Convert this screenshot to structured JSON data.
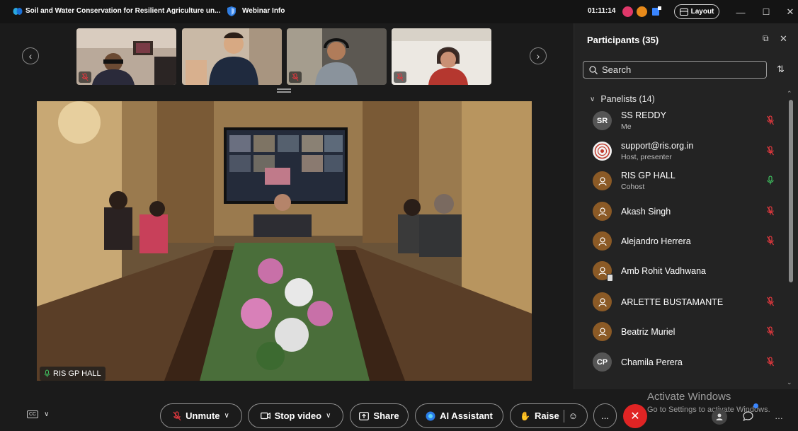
{
  "titlebar": {
    "meeting_title": "Soil and Water Conservation for Resilient Agriculture un...",
    "webinar_info": "Webinar Info",
    "timer": "01:11:14",
    "layout_label": "Layout"
  },
  "thumbnails": [
    {
      "name": "participant-thumb-1",
      "muted": true
    },
    {
      "name": "participant-thumb-2",
      "muted": false
    },
    {
      "name": "participant-thumb-3",
      "muted": true
    },
    {
      "name": "participant-thumb-4",
      "muted": true
    }
  ],
  "main_video": {
    "label": "RIS GP HALL"
  },
  "panel": {
    "title": "Participants (35)",
    "search_placeholder": "Search",
    "section_label": "Panelists (14)",
    "participants": [
      {
        "initials": "SR",
        "name": "SS REDDY",
        "role": "Me",
        "avatar": "initials",
        "mic": "muted"
      },
      {
        "initials": "",
        "name": "support@ris.org.in",
        "role": "Host, presenter",
        "avatar": "logo",
        "mic": "muted"
      },
      {
        "initials": "",
        "name": "RIS GP HALL",
        "role": "Cohost",
        "avatar": "user",
        "mic": "active"
      },
      {
        "initials": "",
        "name": "Akash Singh",
        "role": "",
        "avatar": "user",
        "mic": "muted"
      },
      {
        "initials": "",
        "name": "Alejandro Herrera",
        "role": "",
        "avatar": "user",
        "mic": "muted"
      },
      {
        "initials": "",
        "name": "Amb Rohit Vadhwana",
        "role": "",
        "avatar": "user-phone",
        "mic": "none"
      },
      {
        "initials": "",
        "name": "ARLETTE BUSTAMANTE",
        "role": "",
        "avatar": "user",
        "mic": "muted"
      },
      {
        "initials": "",
        "name": "Beatriz Muriel",
        "role": "",
        "avatar": "user",
        "mic": "muted"
      },
      {
        "initials": "CP",
        "name": "Chamila Perera",
        "role": "",
        "avatar": "initials",
        "mic": "muted"
      }
    ]
  },
  "controls": {
    "unmute": "Unmute",
    "stop_video": "Stop video",
    "share": "Share",
    "ai_assistant": "AI Assistant",
    "raise": "Raise",
    "more": "..."
  },
  "watermark": {
    "line1": "Activate Windows",
    "line2": "Go to Settings to activate Windows."
  },
  "colors": {
    "muted_red": "#e0383e",
    "active_green": "#3fbf5f",
    "end_red": "#e02424",
    "avatar_brown": "#8b5a26"
  }
}
